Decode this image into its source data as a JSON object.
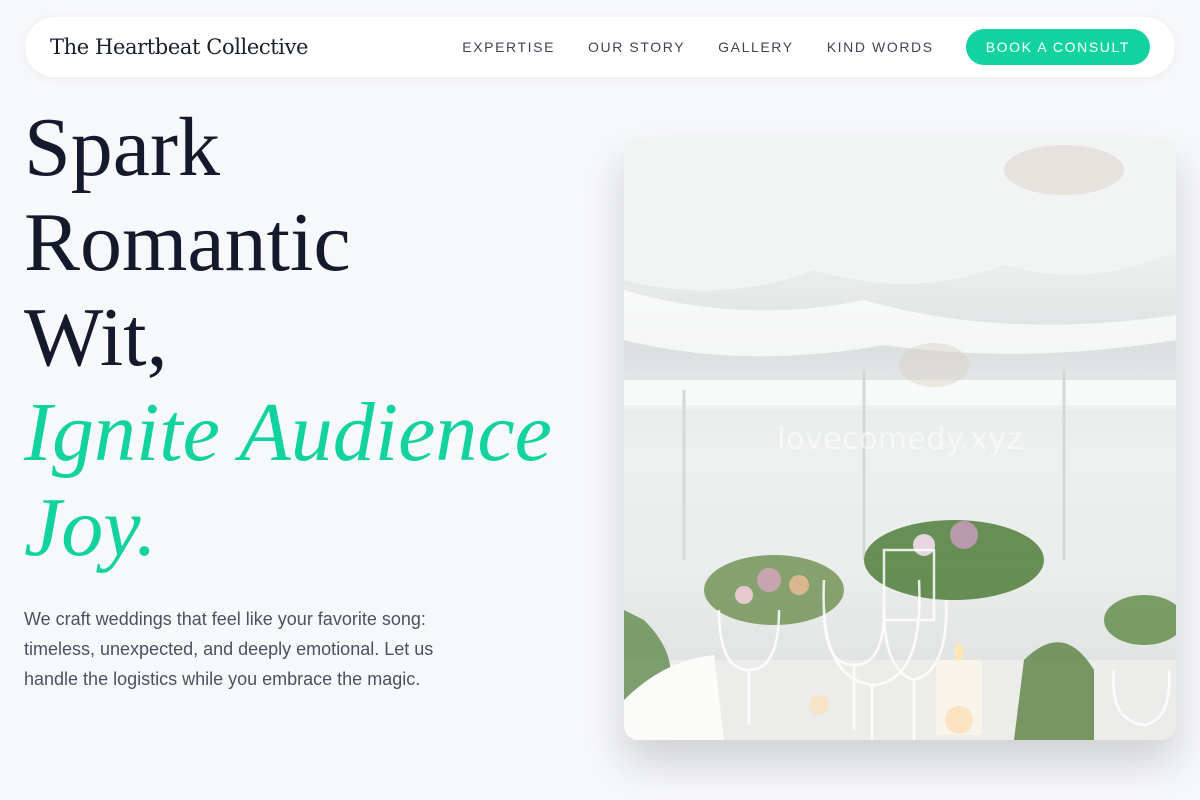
{
  "brand": {
    "name": "The Heartbeat Collective"
  },
  "nav": {
    "links": [
      "EXPERTISE",
      "OUR STORY",
      "GALLERY",
      "KIND WORDS"
    ],
    "cta": "BOOK A CONSULT"
  },
  "hero": {
    "line1": "Spark",
    "line2": "Romantic",
    "line3": "Wit,",
    "accent_line1": "Ignite Audience",
    "accent_line2": "Joy.",
    "description": "We craft weddings that feel like your favorite song: timeless, unexpected, and deeply emotional. Let us handle the logistics while you embrace the magic."
  },
  "image": {
    "subject": "wedding reception table with glasses, flowers and candles under a draped tent",
    "watermark": "lovecomedy.xyz"
  },
  "colors": {
    "accent": "#12d3a0",
    "text": "#141a2c",
    "background": "#f7f8fa"
  }
}
